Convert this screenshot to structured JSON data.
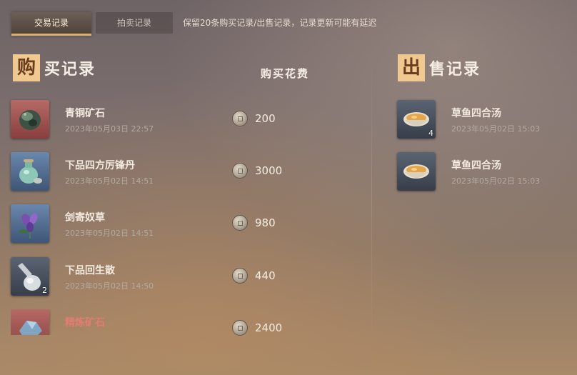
{
  "tabs": [
    {
      "label": "交易记录",
      "active": true
    },
    {
      "label": "拍卖记录",
      "active": false
    }
  ],
  "notice": "保留20条购买记录/出售记录，记录更新可能有延迟",
  "buy": {
    "title_badge": "购",
    "title_rest": "买记录",
    "cost_header": "购买花费",
    "items": [
      {
        "name": "青铜矿石",
        "time": "2023年05月03日 22:57",
        "price": "200",
        "count": "",
        "rarity": "red",
        "icon": "bronze-ore-icon"
      },
      {
        "name": "下品四方厉锋丹",
        "time": "2023年05月02日 14:51",
        "price": "3000",
        "count": "",
        "rarity": "blue",
        "icon": "pill-bottle-icon"
      },
      {
        "name": "剑寄奴草",
        "time": "2023年05月02日 14:51",
        "price": "980",
        "count": "",
        "rarity": "blue",
        "icon": "purple-herb-icon"
      },
      {
        "name": "下品回生散",
        "time": "2023年05月02日 14:50",
        "price": "440",
        "count": "2",
        "rarity": "gray",
        "icon": "gourd-flask-icon"
      },
      {
        "name": "精炼矿石",
        "time": "",
        "price": "2400",
        "count": "",
        "rarity": "red",
        "icon": "refined-ore-icon"
      }
    ]
  },
  "sell": {
    "title_badge": "出",
    "title_rest": "售记录",
    "items": [
      {
        "name": "草鱼四合汤",
        "time": "2023年05月02日 15:03",
        "count": "4",
        "rarity": "gray",
        "icon": "soup-bowl-icon"
      },
      {
        "name": "草鱼四合汤",
        "time": "2023年05月02日 15:03",
        "count": "",
        "rarity": "gray",
        "icon": "soup-bowl-icon"
      }
    ]
  },
  "colors": {
    "accent": "#d7b072",
    "badge": "#f0c890",
    "rare_text": "#e27c73"
  }
}
